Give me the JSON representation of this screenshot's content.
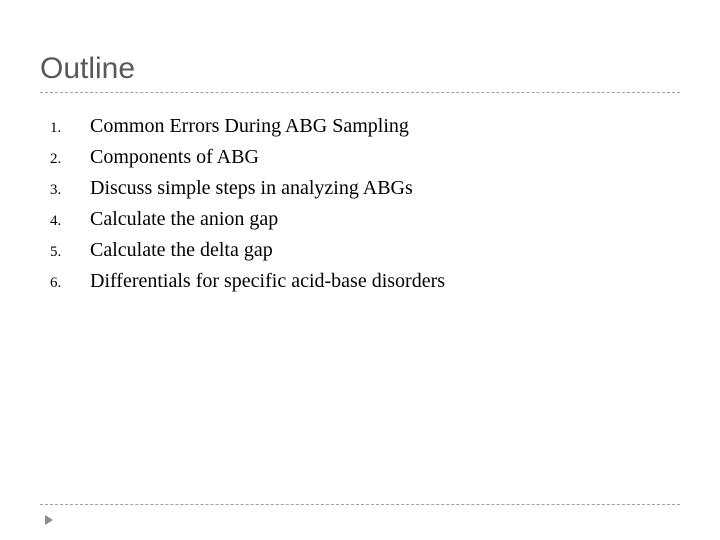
{
  "title": "Outline",
  "items": [
    {
      "text": "Common Errors During ABG Sampling"
    },
    {
      "text": "Components of ABG"
    },
    {
      "text": "Discuss simple steps in analyzing ABGs"
    },
    {
      "text": "Calculate the anion gap"
    },
    {
      "text": "Calculate the delta gap"
    },
    {
      "text": "Differentials for specific acid-base disorders"
    }
  ]
}
